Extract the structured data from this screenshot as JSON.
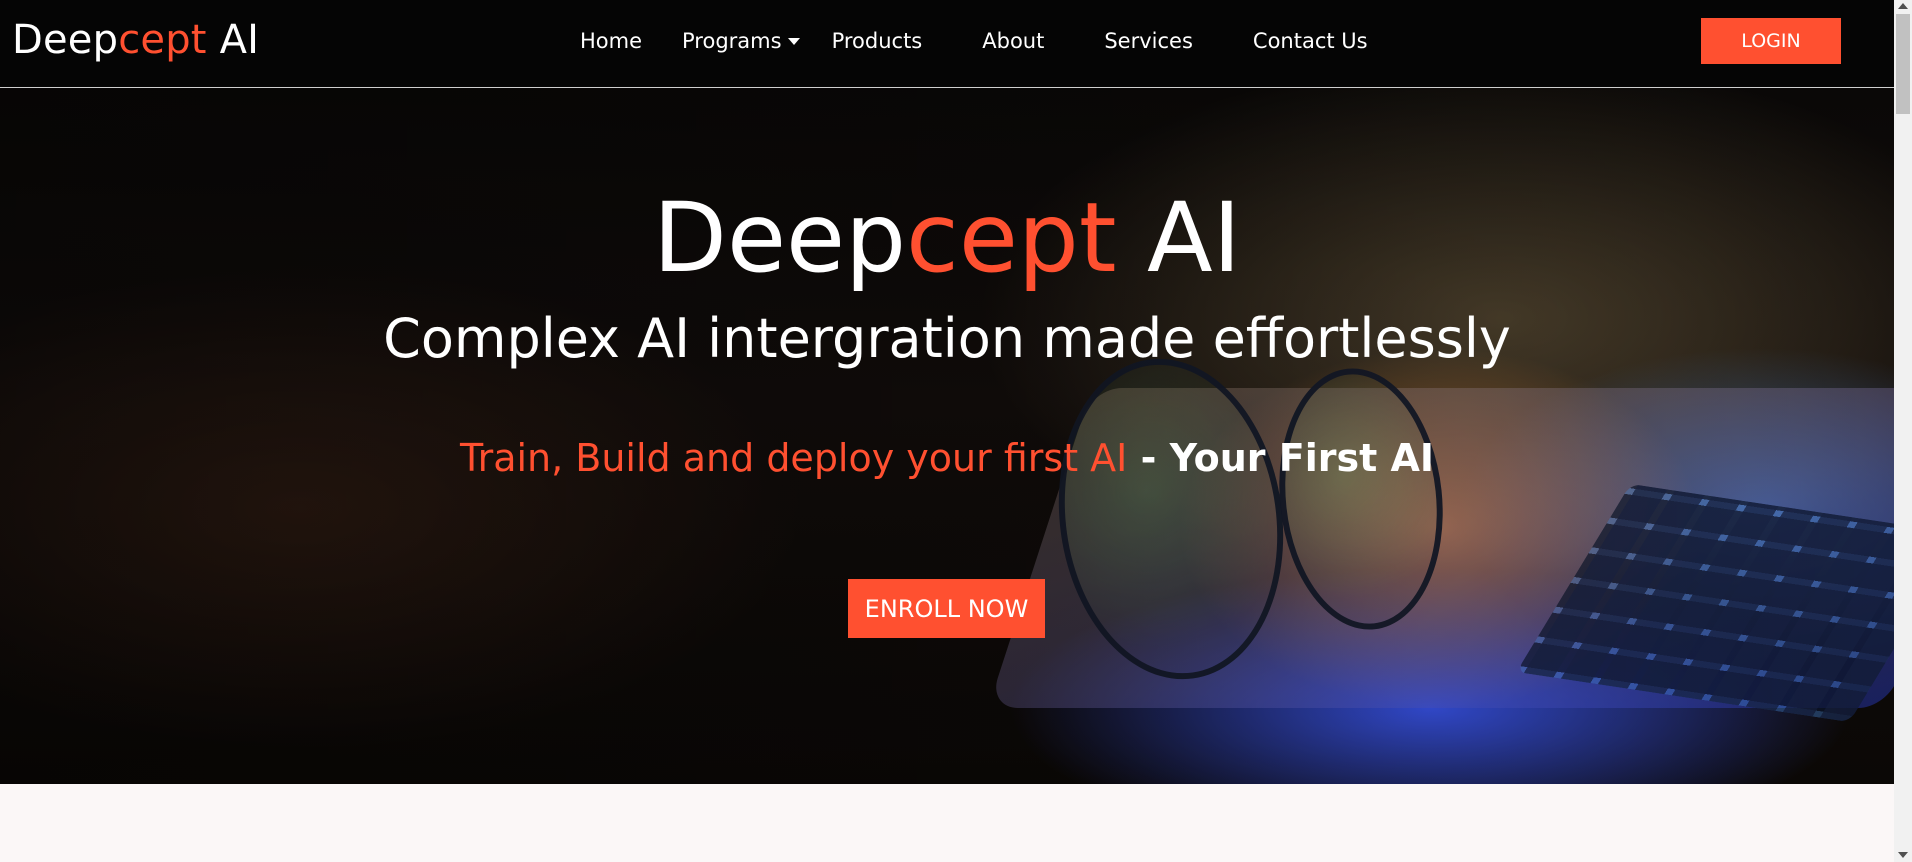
{
  "brand": {
    "part1": "Deep",
    "part2": "cept",
    "part3": " AI"
  },
  "nav": {
    "home": "Home",
    "programs": "Programs",
    "products": "Products",
    "about": "About",
    "services": "Services",
    "contact": "Contact Us",
    "login": "LOGIN"
  },
  "hero": {
    "title_part1": "Deep",
    "title_part2": "cept",
    "title_part3": " AI",
    "subtitle": "Complex AI intergration made effortlessly",
    "tagline_orange": "Train, Build and deploy your first AI",
    "tagline_white": " - Your First AI",
    "enroll": "ENROLL NOW"
  },
  "colors": {
    "accent": "#ff5030",
    "navbar_bg": "#050505",
    "page_bg": "#fbf7f7"
  },
  "icons": {
    "programs_dropdown": "chevron-down-icon",
    "scroll_up": "scroll-up-icon",
    "scroll_down": "scroll-down-icon"
  }
}
